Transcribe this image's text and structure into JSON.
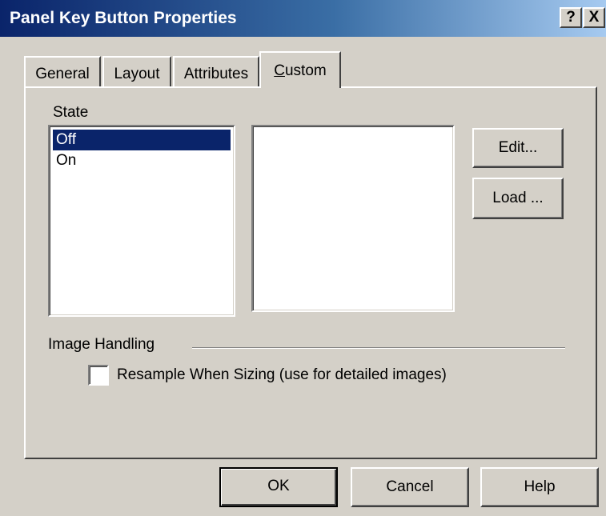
{
  "window": {
    "title": "Panel Key Button Properties",
    "help_label": "?",
    "close_label": "X"
  },
  "tabs": [
    {
      "label": "General"
    },
    {
      "label": "Layout"
    },
    {
      "label": "Attributes"
    },
    {
      "label_prefix": "C",
      "label_rest": "ustom",
      "active": true
    }
  ],
  "state": {
    "label": "State",
    "items": [
      {
        "label": "Off",
        "selected": true
      },
      {
        "label": "On",
        "selected": false
      }
    ]
  },
  "buttons": {
    "edit": "Edit...",
    "load": "Load ..."
  },
  "image_handling": {
    "label": "Image Handling",
    "resample_label": "Resample When Sizing (use for detailed images)",
    "resample_checked": false
  },
  "footer": {
    "ok": "OK",
    "cancel": "Cancel",
    "help": "Help"
  },
  "colors": {
    "face": "#d4d0c8",
    "title_start": "#0a246a",
    "title_end": "#a6caf0",
    "selection": "#0a246a"
  }
}
